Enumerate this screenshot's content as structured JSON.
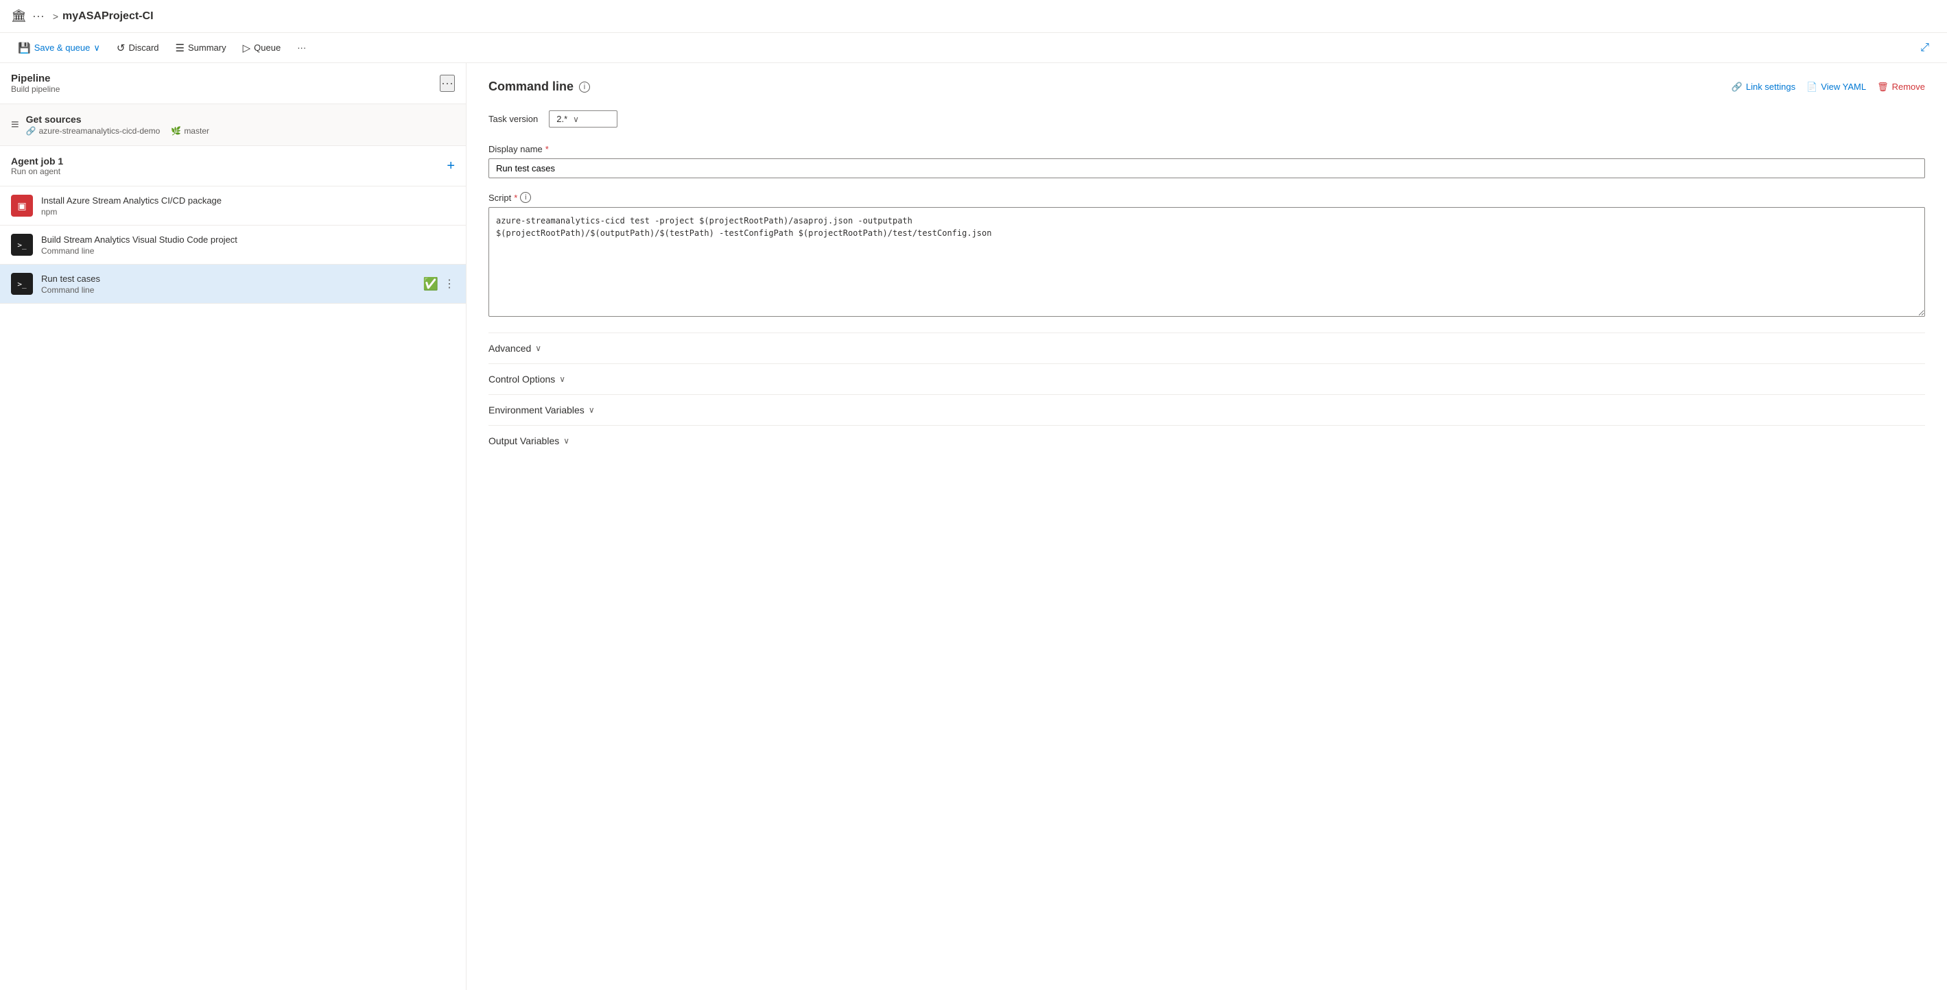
{
  "topbar": {
    "icon": "🏛",
    "dots": "···",
    "chevron": ">",
    "title": "myASAProject-CI"
  },
  "toolbar": {
    "save_queue_label": "Save & queue",
    "discard_label": "Discard",
    "summary_label": "Summary",
    "queue_label": "Queue",
    "more_icon": "···",
    "expand_icon": "⤢"
  },
  "leftpanel": {
    "pipeline_title": "Pipeline",
    "pipeline_subtitle": "Build pipeline",
    "pipeline_more": "···",
    "get_sources_title": "Get sources",
    "get_sources_repo": "azure-streamanalytics-cicd-demo",
    "get_sources_branch": "master",
    "agent_job_title": "Agent job 1",
    "agent_job_subtitle": "Run on agent",
    "tasks": [
      {
        "id": "task-install",
        "icon_char": "▣",
        "icon_color": "red",
        "title": "Install Azure Stream Analytics CI/CD package",
        "subtitle": "npm",
        "selected": false
      },
      {
        "id": "task-build",
        "icon_char": ">_",
        "icon_color": "dark",
        "title": "Build Stream Analytics Visual Studio Code project",
        "subtitle": "Command line",
        "selected": false
      },
      {
        "id": "task-run",
        "icon_char": ">_",
        "icon_color": "dark",
        "title": "Run test cases",
        "subtitle": "Command line",
        "selected": true
      }
    ]
  },
  "rightpanel": {
    "title": "Command line",
    "link_settings_label": "Link settings",
    "view_yaml_label": "View YAML",
    "remove_label": "Remove",
    "task_version_label": "Task version",
    "task_version_value": "2.*",
    "display_name_label": "Display name",
    "display_name_required": true,
    "display_name_value": "Run test cases",
    "script_label": "Script",
    "script_required": true,
    "script_value": "azure-streamanalytics-cicd test -project $(projectRootPath)/asaproj.json -outputpath\n$(projectRootPath)/$(outputPath)/$(testPath) -testConfigPath $(projectRootPath)/test/testConfig.json",
    "sections": [
      {
        "id": "advanced",
        "label": "Advanced"
      },
      {
        "id": "control-options",
        "label": "Control Options"
      },
      {
        "id": "environment-variables",
        "label": "Environment Variables"
      },
      {
        "id": "output-variables",
        "label": "Output Variables"
      }
    ]
  }
}
